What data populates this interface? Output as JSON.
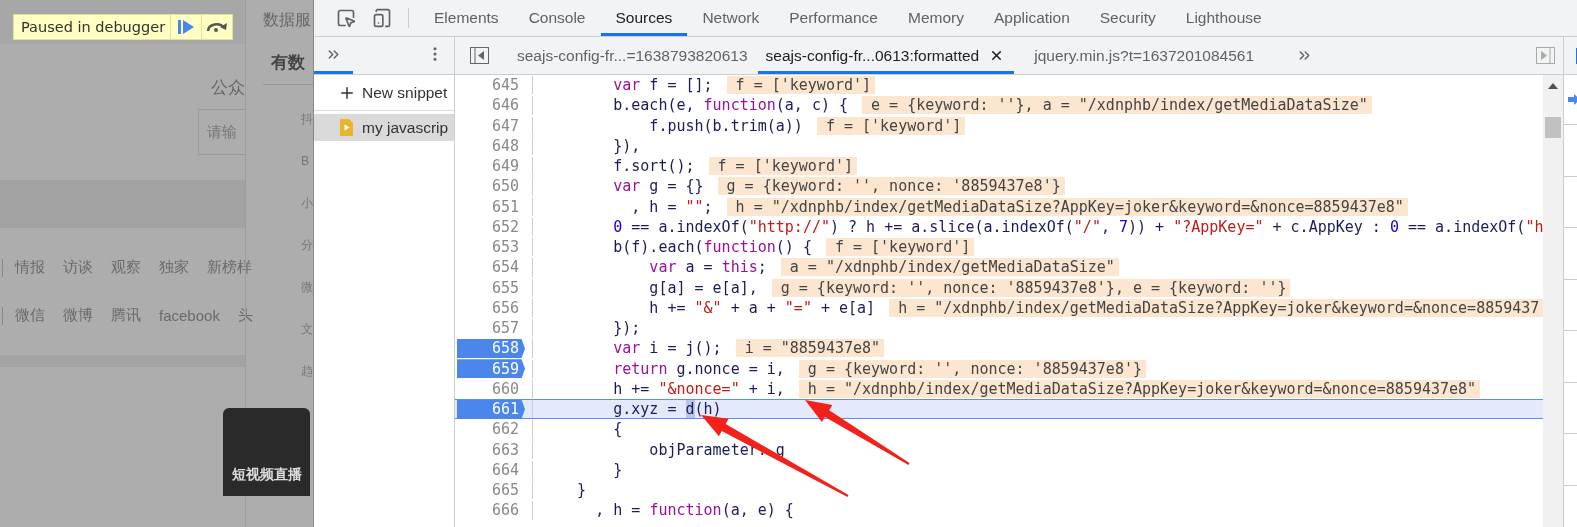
{
  "page": {
    "debugger_banner": {
      "label": "Paused in debugger"
    },
    "sidebar_heading": "数据服",
    "brand": "有数",
    "section_label": "公众",
    "search": {
      "placeholder": "请输"
    },
    "side_items": [
      "抖",
      "B",
      "小",
      "分",
      "微",
      "文",
      "趋"
    ],
    "tag_rows": [
      [
        "情报",
        "访谈",
        "观察",
        "独家",
        "新榜样"
      ],
      [
        "微信",
        "微博",
        "腾讯",
        "facebook",
        "头"
      ]
    ],
    "floating_card": "短视频直播"
  },
  "devtools": {
    "panels": [
      {
        "label": "Elements",
        "selected": false
      },
      {
        "label": "Console",
        "selected": false
      },
      {
        "label": "Sources",
        "selected": true
      },
      {
        "label": "Network",
        "selected": false
      },
      {
        "label": "Performance",
        "selected": false
      },
      {
        "label": "Memory",
        "selected": false
      },
      {
        "label": "Application",
        "selected": false
      },
      {
        "label": "Security",
        "selected": false
      },
      {
        "label": "Lighthouse",
        "selected": false
      }
    ],
    "navigator": {
      "new_snippet": "New snippet",
      "items": [
        {
          "label": "my javascrip",
          "selected": true
        }
      ]
    },
    "editor_tabs": [
      {
        "label": "seajs-config-fr...=1638793820613",
        "selected": false
      },
      {
        "label": "seajs-config-fr...0613:formatted",
        "selected": true
      },
      {
        "label": "jquery.min.js?t=1637201084561",
        "selected": false
      }
    ],
    "lines": [
      {
        "number": "645",
        "breakpoint": false,
        "current": false,
        "tokens": [
          {
            "kind": "kw",
            "text": "        var"
          },
          {
            "kind": "p",
            "text": " f = [];"
          }
        ],
        "value": "f = ['keyword']"
      },
      {
        "number": "646",
        "breakpoint": false,
        "current": false,
        "tokens": [
          {
            "kind": "p",
            "text": "        b.each(e, "
          },
          {
            "kind": "kw",
            "text": "function"
          },
          {
            "kind": "p",
            "text": "(a, c) {"
          }
        ],
        "value": "e = {keyword: ''}, a = \"/xdnphb/index/getMediaDataSize\""
      },
      {
        "number": "647",
        "breakpoint": false,
        "current": false,
        "tokens": [
          {
            "kind": "p",
            "text": "            f.push(b.trim(a))"
          }
        ],
        "value": "f = ['keyword']"
      },
      {
        "number": "648",
        "breakpoint": false,
        "current": false,
        "tokens": [
          {
            "kind": "p",
            "text": "        }),"
          }
        ]
      },
      {
        "number": "649",
        "breakpoint": false,
        "current": false,
        "tokens": [
          {
            "kind": "p",
            "text": "        f.sort();"
          }
        ],
        "value": "f = ['keyword']"
      },
      {
        "number": "650",
        "breakpoint": false,
        "current": false,
        "tokens": [
          {
            "kind": "kw",
            "text": "        var"
          },
          {
            "kind": "p",
            "text": " g = {}"
          }
        ],
        "value": "g = {keyword: '', nonce: '8859437e8'}"
      },
      {
        "number": "651",
        "breakpoint": false,
        "current": false,
        "tokens": [
          {
            "kind": "p",
            "text": "          , h = "
          },
          {
            "kind": "str",
            "text": "\"\""
          },
          {
            "kind": "p",
            "text": ";"
          }
        ],
        "value": "h = \"/xdnphb/index/getMediaDataSize?AppKey=joker&keyword=&nonce=8859437e8\""
      },
      {
        "number": "652",
        "breakpoint": false,
        "current": false,
        "tokens": [
          {
            "kind": "num",
            "text": "        0"
          },
          {
            "kind": "p",
            "text": " == a.indexOf("
          },
          {
            "kind": "str",
            "text": "\"http://\""
          },
          {
            "kind": "p",
            "text": ") ? h += a.slice(a.indexOf("
          },
          {
            "kind": "str",
            "text": "\"/\""
          },
          {
            "kind": "p",
            "text": ", "
          },
          {
            "kind": "num",
            "text": "7"
          },
          {
            "kind": "p",
            "text": ")) + "
          },
          {
            "kind": "str",
            "text": "\"?AppKey=\""
          },
          {
            "kind": "p",
            "text": " + c.AppKey : "
          },
          {
            "kind": "num",
            "text": "0"
          },
          {
            "kind": "p",
            "text": " == a.indexOf("
          },
          {
            "kind": "str",
            "text": "\"h"
          }
        ]
      },
      {
        "number": "653",
        "breakpoint": false,
        "current": false,
        "tokens": [
          {
            "kind": "p",
            "text": "        b(f).each("
          },
          {
            "kind": "kw",
            "text": "function"
          },
          {
            "kind": "p",
            "text": "() {"
          }
        ],
        "value": "f = ['keyword']"
      },
      {
        "number": "654",
        "breakpoint": false,
        "current": false,
        "tokens": [
          {
            "kind": "kw",
            "text": "            var"
          },
          {
            "kind": "p",
            "text": " a = "
          },
          {
            "kind": "kw",
            "text": "this"
          },
          {
            "kind": "p",
            "text": ";"
          }
        ],
        "value": "a = \"/xdnphb/index/getMediaDataSize\""
      },
      {
        "number": "655",
        "breakpoint": false,
        "current": false,
        "tokens": [
          {
            "kind": "p",
            "text": "            g[a] = e[a],"
          }
        ],
        "value": "g = {keyword: '', nonce: '8859437e8'}, e = {keyword: ''}"
      },
      {
        "number": "656",
        "breakpoint": false,
        "current": false,
        "tokens": [
          {
            "kind": "p",
            "text": "            h += "
          },
          {
            "kind": "str",
            "text": "\"&\""
          },
          {
            "kind": "p",
            "text": " + a + "
          },
          {
            "kind": "str",
            "text": "\"=\""
          },
          {
            "kind": "p",
            "text": " + e[a]"
          }
        ],
        "value": "h = \"/xdnphb/index/getMediaDataSize?AppKey=joker&keyword=&nonce=8859437"
      },
      {
        "number": "657",
        "breakpoint": false,
        "current": false,
        "tokens": [
          {
            "kind": "p",
            "text": "        });"
          }
        ]
      },
      {
        "number": "658",
        "breakpoint": true,
        "current": false,
        "tokens": [
          {
            "kind": "kw",
            "text": "        var"
          },
          {
            "kind": "p",
            "text": " i = j();"
          }
        ],
        "value": "i = \"8859437e8\""
      },
      {
        "number": "659",
        "breakpoint": true,
        "current": false,
        "tokens": [
          {
            "kind": "kw",
            "text": "        return"
          },
          {
            "kind": "p",
            "text": " g.nonce = i,"
          }
        ],
        "value": "g = {keyword: '', nonce: '8859437e8'}"
      },
      {
        "number": "660",
        "breakpoint": false,
        "current": false,
        "tokens": [
          {
            "kind": "p",
            "text": "        h += "
          },
          {
            "kind": "str",
            "text": "\"&nonce=\""
          },
          {
            "kind": "p",
            "text": " + i,"
          }
        ],
        "value": "h = \"/xdnphb/index/getMediaDataSize?AppKey=joker&keyword=&nonce=8859437e8\""
      },
      {
        "number": "661",
        "breakpoint": true,
        "current": true,
        "tokens": [
          {
            "kind": "p",
            "text": "        g.xyz = "
          },
          {
            "kind": "sel",
            "text": "d"
          },
          {
            "kind": "p",
            "text": "(h)"
          }
        ]
      },
      {
        "number": "662",
        "breakpoint": false,
        "current": false,
        "tokens": [
          {
            "kind": "p",
            "text": "        {"
          }
        ]
      },
      {
        "number": "663",
        "breakpoint": false,
        "current": false,
        "tokens": [
          {
            "kind": "p",
            "text": "            objParameter: g"
          }
        ]
      },
      {
        "number": "664",
        "breakpoint": false,
        "current": false,
        "tokens": [
          {
            "kind": "p",
            "text": "        }"
          }
        ]
      },
      {
        "number": "665",
        "breakpoint": false,
        "current": false,
        "tokens": [
          {
            "kind": "p",
            "text": "    }"
          }
        ]
      },
      {
        "number": "666",
        "breakpoint": false,
        "current": false,
        "tokens": [
          {
            "kind": "p",
            "text": "      , h = "
          },
          {
            "kind": "kw",
            "text": "function"
          },
          {
            "kind": "p",
            "text": "(a, e) {"
          }
        ]
      }
    ]
  }
}
